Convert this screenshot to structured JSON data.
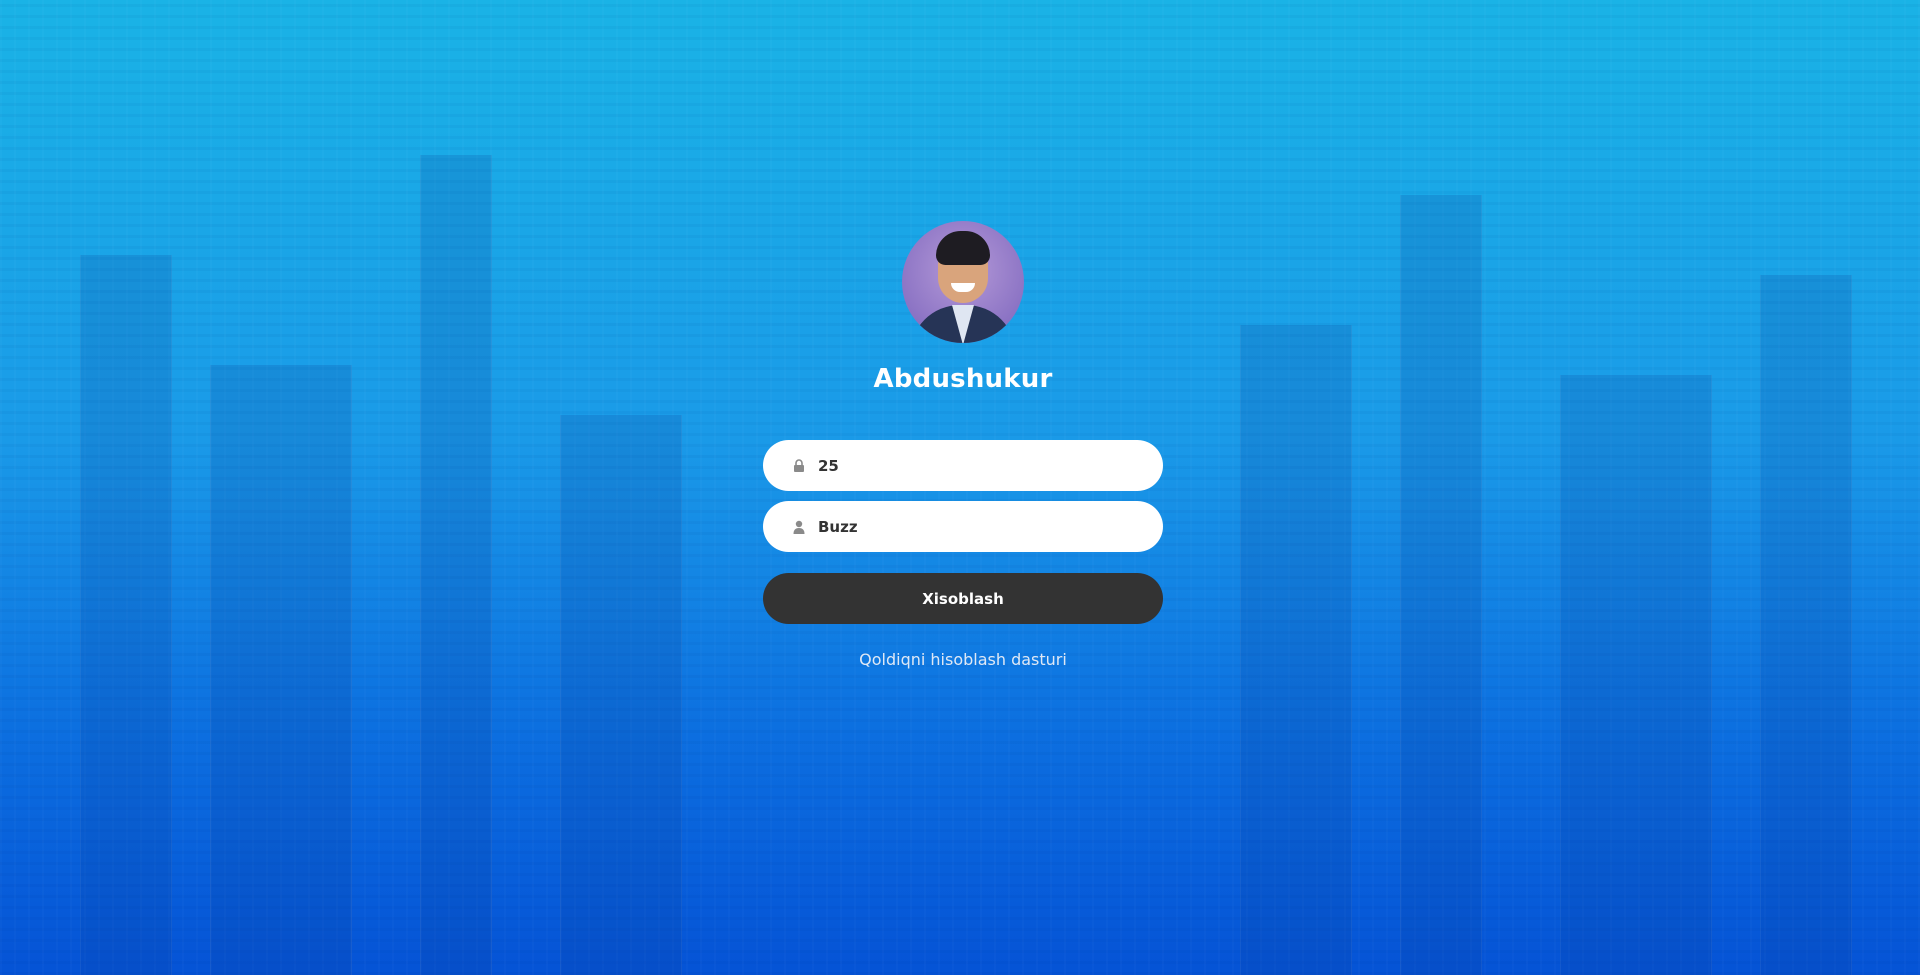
{
  "profile": {
    "name": "Abdushukur"
  },
  "form": {
    "field_1": {
      "value": "25",
      "icon": "lock-icon"
    },
    "field_2": {
      "value": "Buzz",
      "icon": "user-icon"
    },
    "submit_label": "Xisoblash",
    "caption": "Qoldiqni hisoblash dasturi"
  },
  "colors": {
    "background_top": "#1ab3e6",
    "background_bottom": "#0553d6",
    "button": "#333333",
    "field": "#ffffff"
  }
}
